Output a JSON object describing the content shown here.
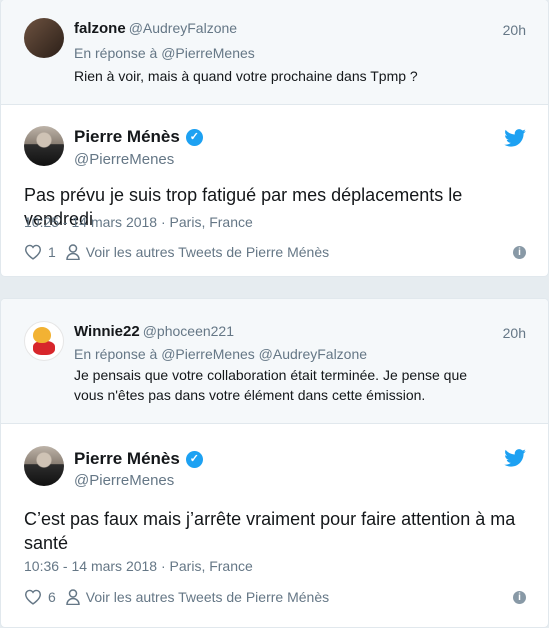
{
  "threads": [
    {
      "parent": {
        "name": "falzone",
        "handle": "@AudreyFalzone",
        "time": "20h",
        "reply_label": "En réponse à",
        "reply_to": "@PierreMenes",
        "text": "Rien à voir, mais à quand votre prochaine dans Tpmp ?"
      },
      "main": {
        "name": "Pierre Ménès",
        "handle": "@PierreMenes",
        "text": "Pas prévu je suis trop fatigué par mes déplacements le vendredi",
        "datetime": "10:25 - 14 mars 2018",
        "separator": "·",
        "location": "Paris, France",
        "likes": "1",
        "more_tweets": "Voir les autres Tweets de Pierre Ménès"
      }
    },
    {
      "parent": {
        "name": "Winnie22",
        "handle": "@phoceen221",
        "time": "20h",
        "reply_label": "En réponse à",
        "reply_to": "@PierreMenes @AudreyFalzone",
        "text_line1": "Je pensais que votre collaboration était terminée. Je pense que",
        "text_line2": "vous n'êtes pas dans votre élément dans cette émission."
      },
      "main": {
        "name": "Pierre Ménès",
        "handle": "@PierreMenes",
        "text_line1": "C’est pas faux mais j’arrête vraiment pour faire attention à ma",
        "text_line2": "santé",
        "datetime": "10:36 - 14 mars 2018",
        "separator": "·",
        "location": "Paris, France",
        "likes": "6",
        "more_tweets": "Voir les autres Tweets de Pierre Ménès"
      }
    }
  ],
  "icons": {
    "verified": "verified-badge-icon",
    "twitter": "twitter-bird-icon",
    "heart": "heart-icon",
    "person": "person-icon",
    "info": "info-icon"
  },
  "colors": {
    "twitter_blue": "#1da1f2",
    "muted": "#657786",
    "text": "#14171a",
    "background": "#e6ecf0"
  }
}
